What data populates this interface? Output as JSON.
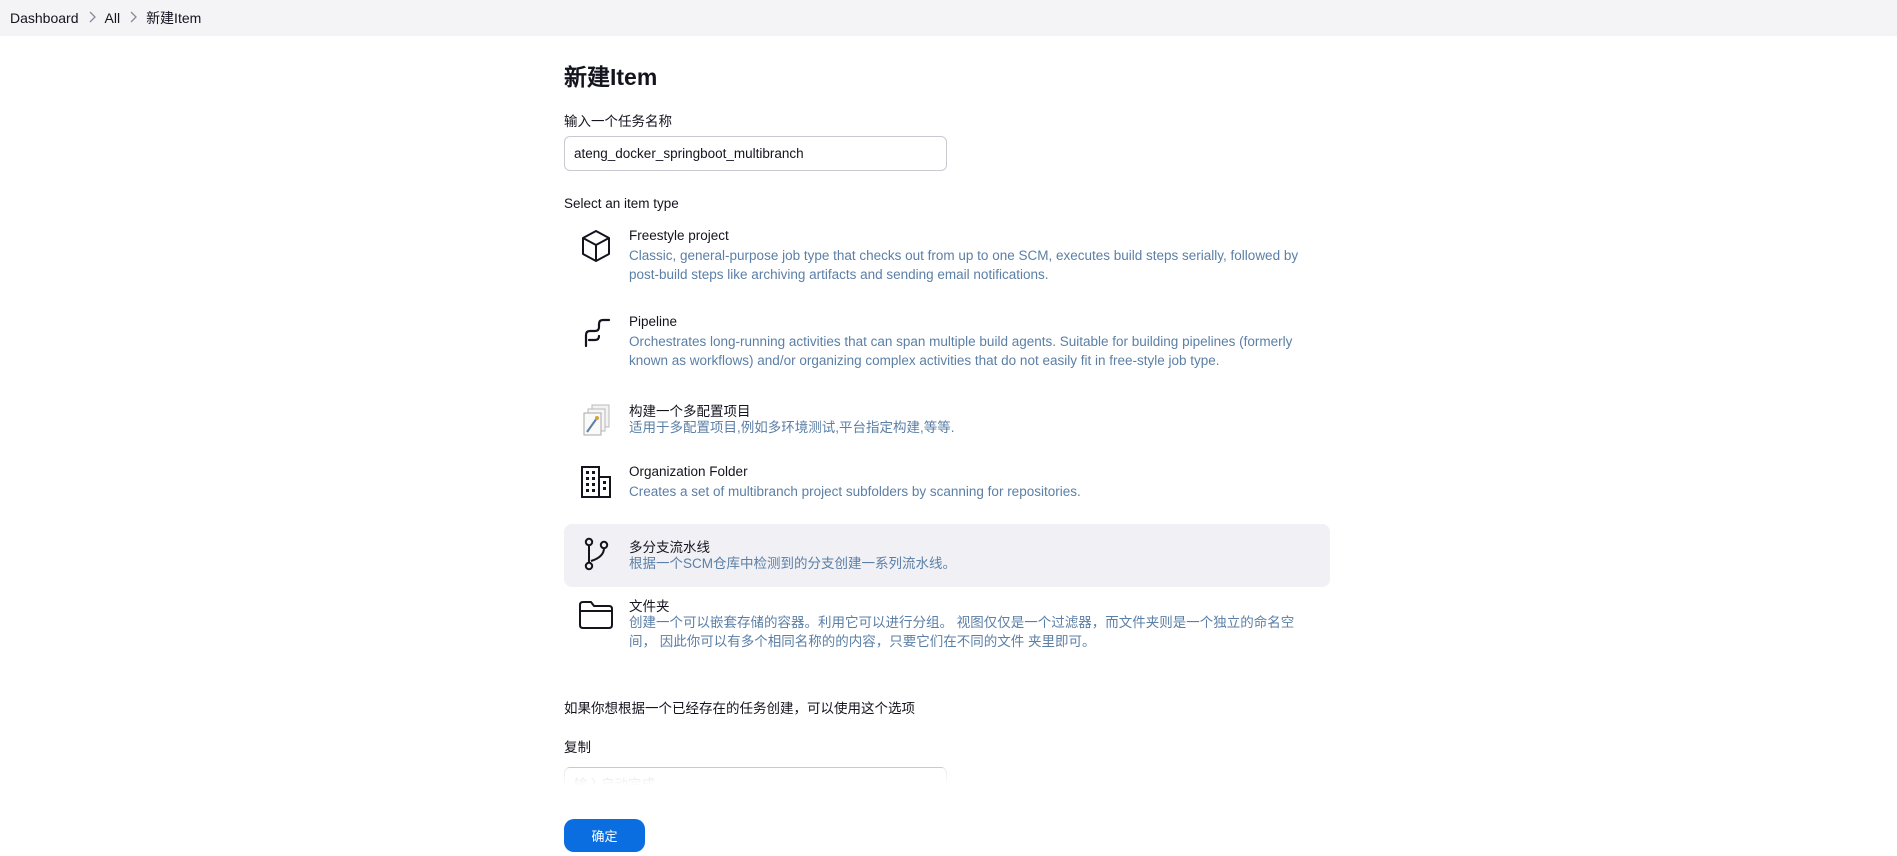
{
  "breadcrumb": {
    "items": [
      "Dashboard",
      "All",
      "新建Item"
    ]
  },
  "page": {
    "title": "新建Item"
  },
  "name_field": {
    "label": "输入一个任务名称",
    "value": "ateng_docker_springboot_multibranch"
  },
  "item_type": {
    "heading": "Select an item type",
    "selected": "多分支流水线",
    "items": [
      {
        "name": "Freestyle project",
        "description": "Classic, general-purpose job type that checks out from up to one SCM, executes build steps serially, followed by post-build steps like archiving artifacts and sending email notifications.",
        "icon": "cube-icon"
      },
      {
        "name": "Pipeline",
        "description": "Orchestrates long-running activities that can span multiple build agents. Suitable for building pipelines (formerly known as workflows) and/or organizing complex activities that do not easily fit in free-style job type.",
        "icon": "pipeline-icon"
      },
      {
        "name": "构建一个多配置项目",
        "description": "适用于多配置项目,例如多环境测试,平台指定构建,等等.",
        "icon": "multi-config-icon"
      },
      {
        "name": "Organization Folder",
        "description": "Creates a set of multibranch project subfolders by scanning for repositories.",
        "icon": "building-icon"
      },
      {
        "name": "多分支流水线",
        "description": "根据一个SCM仓库中检测到的分支创建一系列流水线。",
        "icon": "branch-icon"
      },
      {
        "name": "文件夹",
        "description": "创建一个可以嵌套存储的容器。利用它可以进行分组。 视图仅仅是一个过滤器，而文件夹则是一个独立的命名空间， 因此你可以有多个相同名称的的内容，只要它们在不同的文件 夹里即可。",
        "icon": "folder-icon"
      }
    ]
  },
  "copy_section": {
    "hint": "如果你想根据一个已经存在的任务创建，可以使用这个选项",
    "label": "复制",
    "placeholder": "输入自动完成"
  },
  "actions": {
    "ok_label": "确定",
    "accent_color": "#0b6ee0"
  },
  "colors": {
    "description": "#5b7fa6",
    "selected_background": "#f0f0f5"
  }
}
